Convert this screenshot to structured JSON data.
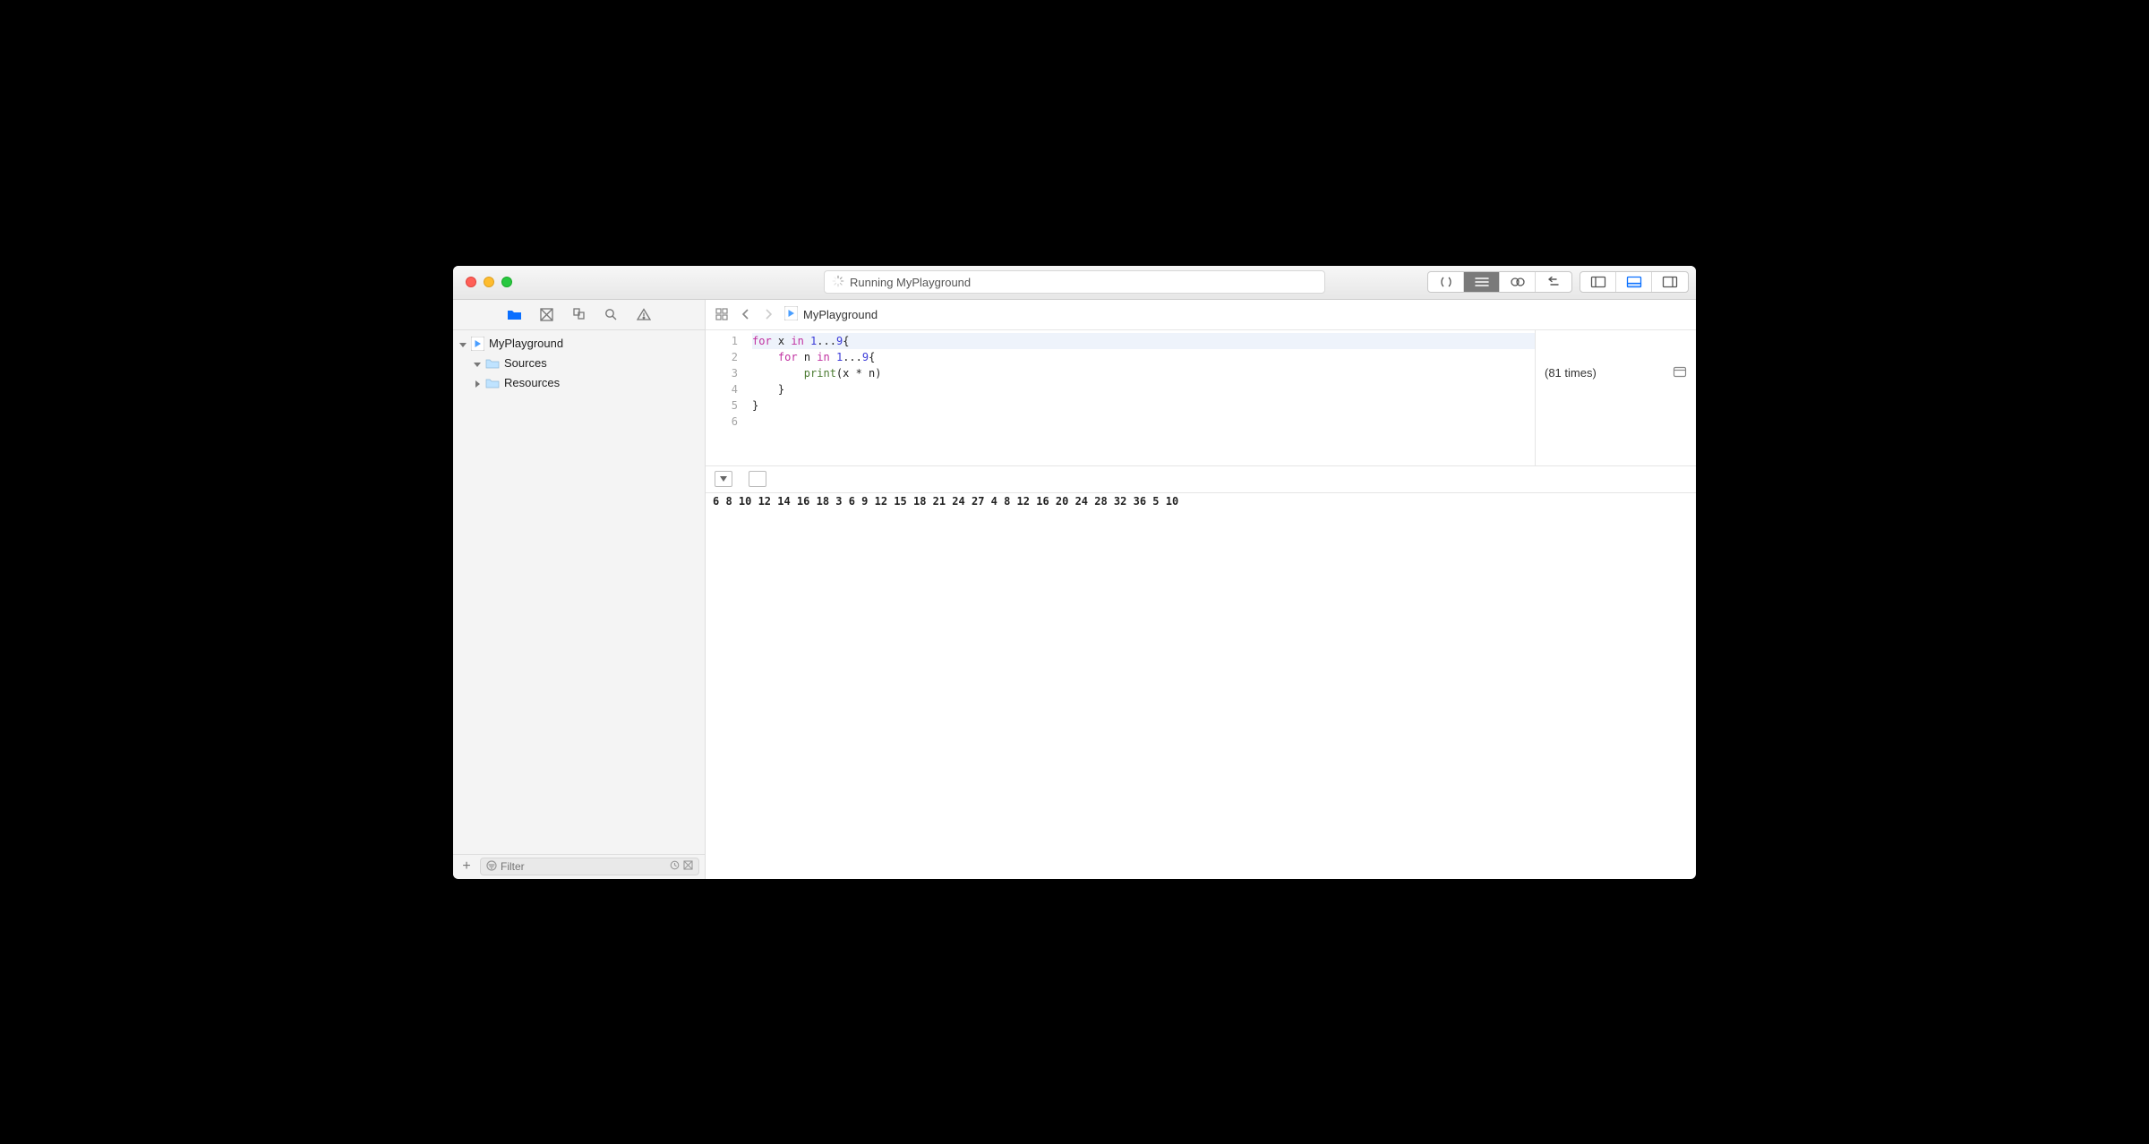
{
  "window": {
    "status_text": "Running MyPlayground"
  },
  "sidebar": {
    "filter_placeholder": "Filter",
    "items": [
      {
        "label": "MyPlayground",
        "type": "playground",
        "indent": 0,
        "expanded": true
      },
      {
        "label": "Sources",
        "type": "folder",
        "indent": 1,
        "expanded": true
      },
      {
        "label": "Resources",
        "type": "folder",
        "indent": 1,
        "expanded": false
      }
    ]
  },
  "jumpbar": {
    "file": "MyPlayground"
  },
  "code": {
    "lines": [
      {
        "n": 1,
        "segs": [
          [
            "kw",
            "for "
          ],
          [
            "op",
            "x "
          ],
          [
            "kw",
            "in "
          ],
          [
            "num",
            "1"
          ],
          [
            "op",
            "..."
          ],
          [
            "num",
            "9"
          ],
          [
            "op",
            "{"
          ]
        ],
        "hl": true
      },
      {
        "n": 2,
        "segs": [
          [
            "op",
            "    "
          ],
          [
            "kw",
            "for "
          ],
          [
            "op",
            "n "
          ],
          [
            "kw",
            "in "
          ],
          [
            "num",
            "1"
          ],
          [
            "op",
            "..."
          ],
          [
            "num",
            "9"
          ],
          [
            "op",
            "{"
          ]
        ]
      },
      {
        "n": 3,
        "segs": [
          [
            "op",
            "        "
          ],
          [
            "fn",
            "print"
          ],
          [
            "op",
            "(x * n)"
          ]
        ]
      },
      {
        "n": 4,
        "segs": [
          [
            "op",
            "    }"
          ]
        ]
      },
      {
        "n": 5,
        "segs": [
          [
            "op",
            "}"
          ]
        ]
      },
      {
        "n": 6,
        "segs": []
      }
    ]
  },
  "results": {
    "line3": "(81 times)"
  },
  "console": {
    "output": [
      "6",
      "8",
      "10",
      "12",
      "14",
      "16",
      "18",
      "3",
      "6",
      "9",
      "12",
      "15",
      "18",
      "21",
      "24",
      "27",
      "4",
      "8",
      "12",
      "16",
      "20",
      "24",
      "28",
      "32",
      "36",
      "5",
      "10"
    ]
  }
}
